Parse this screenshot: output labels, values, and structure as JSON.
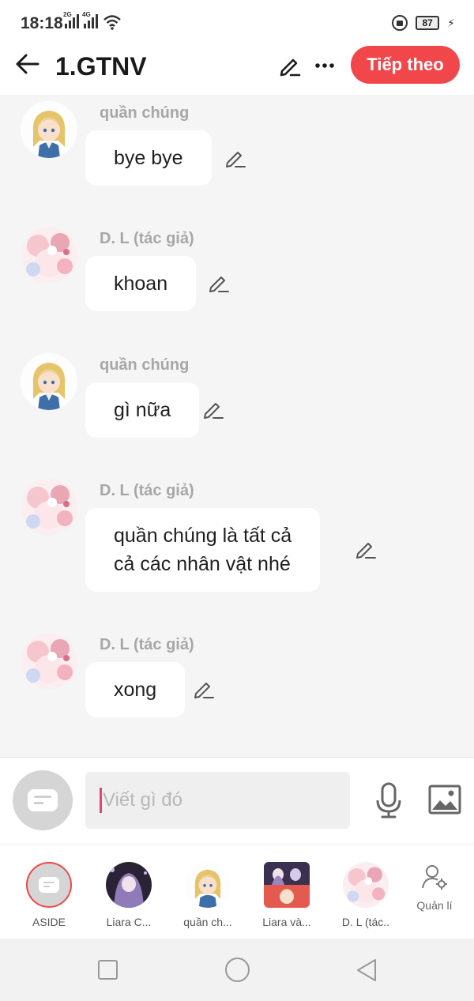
{
  "status": {
    "time": "18:18",
    "net1": "2G",
    "net2": "4G",
    "battery": "87"
  },
  "header": {
    "title": "1.GTNV",
    "next_label": "Tiếp theo"
  },
  "messages": [
    {
      "speaker": "quần chúng",
      "text": "bye bye",
      "avatar": "blonde-girl"
    },
    {
      "speaker": "D. L (tác giả)",
      "text": "khoan",
      "avatar": "pink-floral"
    },
    {
      "speaker": "quần chúng",
      "text": "gì nữa",
      "avatar": "blonde-girl"
    },
    {
      "speaker": "D. L (tác giả)",
      "text": "quần chúng là tất cả\ncả các nhân vật nhé",
      "avatar": "pink-floral"
    },
    {
      "speaker": "D. L (tác giả)",
      "text": "xong",
      "avatar": "pink-floral"
    }
  ],
  "composer": {
    "placeholder": "Viết gì đó"
  },
  "characters": [
    {
      "label": "ASIDE"
    },
    {
      "label": "Liara C..."
    },
    {
      "label": "quần ch..."
    },
    {
      "label": "Liara và..."
    },
    {
      "label": "D. L (tác.."
    }
  ],
  "manage_label": "Quản lí",
  "colors": {
    "accent": "#f2474a",
    "speaker": "#a7a7a7",
    "background": "#f5f5f5"
  }
}
